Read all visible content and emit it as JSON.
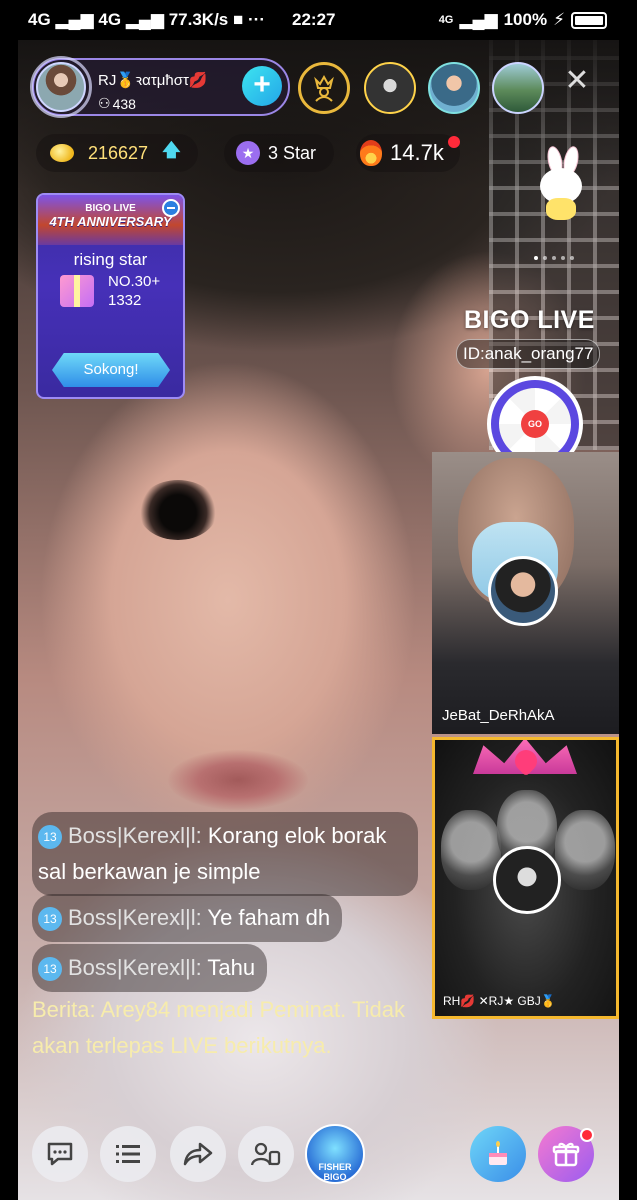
{
  "status_bar": {
    "network": "4G",
    "network2": "4G",
    "speed": "77.3K/s",
    "more": "···",
    "time": "22:27",
    "network_right": "4G",
    "battery": "100%"
  },
  "host": {
    "prefix": "RJ",
    "name": "ꝛατμħστ💋",
    "fans": "438",
    "follow_label": "+"
  },
  "stats": {
    "coins": "216627",
    "stars": "3 Star",
    "hot": "14.7k"
  },
  "anniversary": {
    "brand": "BIGO LIVE",
    "title": "4TH ANNIVERSARY",
    "category": "rising star",
    "rank": "NO.30+",
    "score": "1332",
    "support_label": "Sokong!"
  },
  "overlay": {
    "logo": "BIGO LIVE",
    "room_id": "ID:anak_orang77",
    "go_label": "GO"
  },
  "guests": {
    "guest1_name": "JeBat_DeRhAkA",
    "guest2_names": "RH💋 ✕RJ★ GBJ🥇"
  },
  "chat": [
    {
      "level": "13",
      "user": "Boss|Kerexl|l:",
      "message": "Korang elok borak sal berkawan je simple"
    },
    {
      "level": "13",
      "user": "Boss|Kerexl|l:",
      "message": "Ye faham dh"
    },
    {
      "level": "13",
      "user": "Boss|Kerexl|l:",
      "message": "Tahu"
    }
  ],
  "news": "Berita: Arey84 menjadi Peminat. Tidak akan terlepas LIVE berikutnya.",
  "bottom_bar": {
    "fisher_label": "FISHER BIGO"
  },
  "colors": {
    "accent": "#9b87e6",
    "follow": "#2fb8ee",
    "coins": "#ffe07a",
    "news": "#f7ecac",
    "guest2_border": "#f5b82e"
  }
}
